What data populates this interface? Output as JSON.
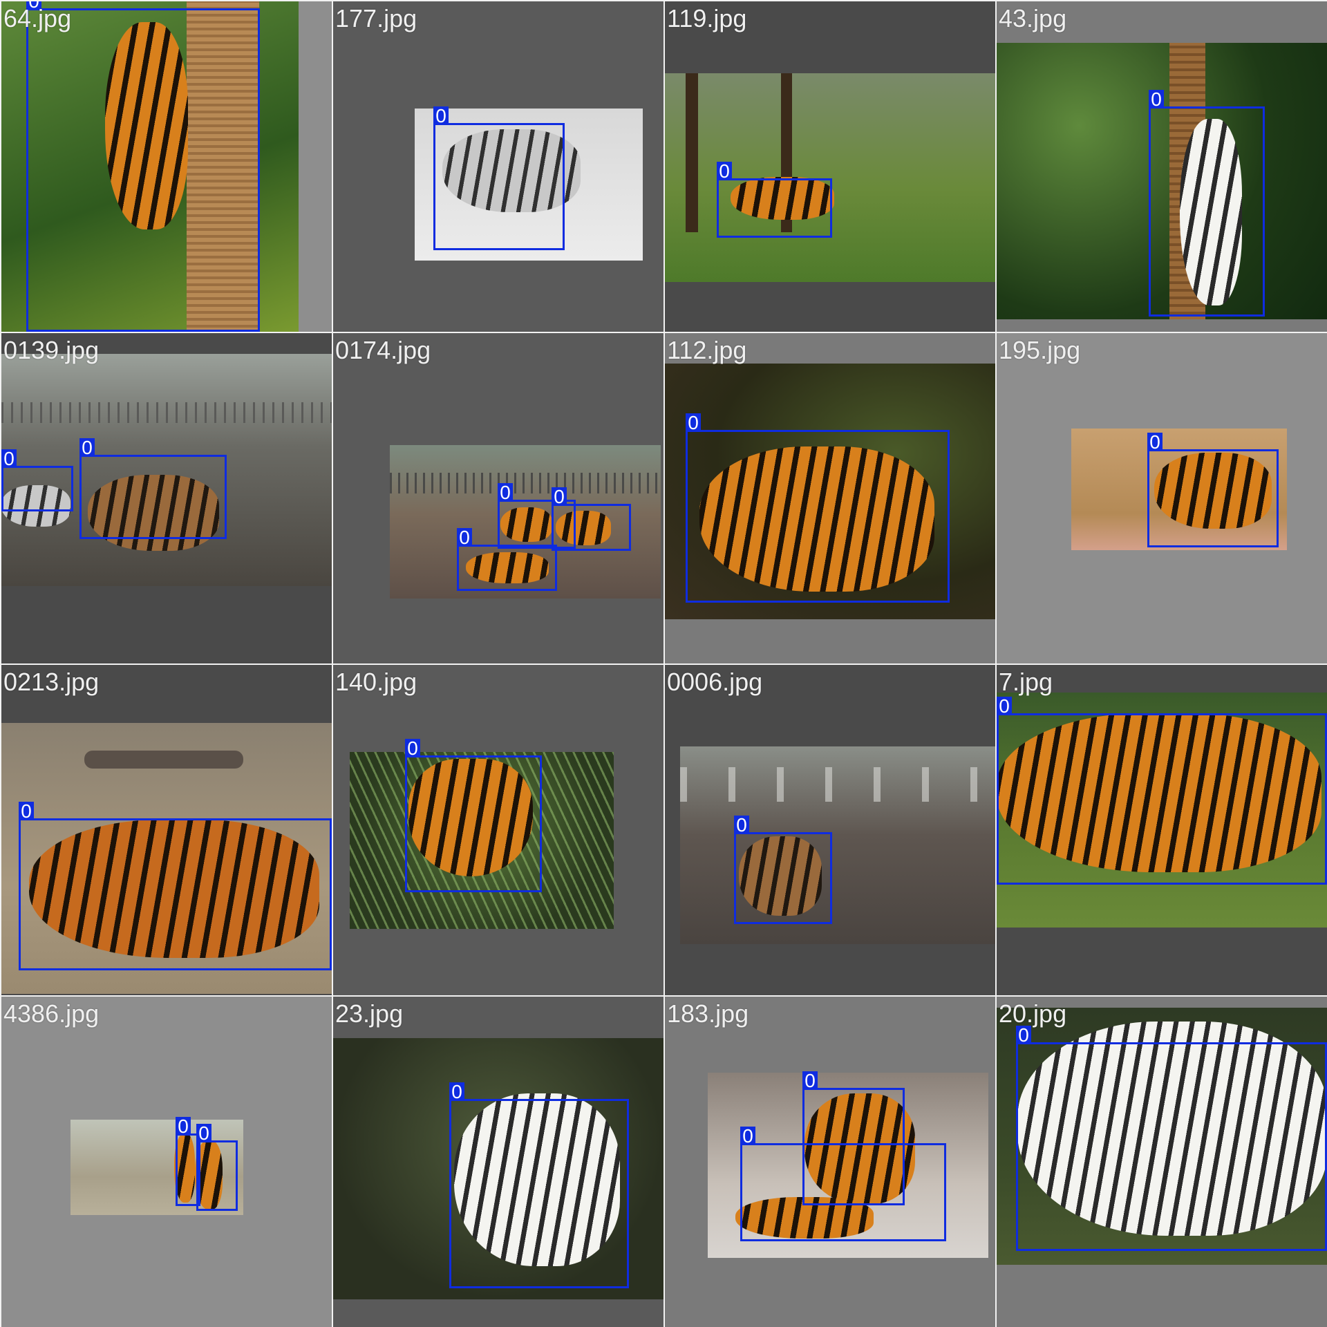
{
  "grid": {
    "box_color": "#0f2ce0",
    "cells": [
      {
        "filename": "64.jpg",
        "bg": "#8e8e8e",
        "label": "0"
      },
      {
        "filename": "177.jpg",
        "bg": "#5a5a5a",
        "label": "0"
      },
      {
        "filename": "119.jpg",
        "bg": "#4a4a4a",
        "label": "0"
      },
      {
        "filename": "43.jpg",
        "bg": "#7a7a7a",
        "label": "0"
      },
      {
        "filename": "0139.jpg",
        "bg": "#4a4a4a",
        "label": "0"
      },
      {
        "filename": "0174.jpg",
        "bg": "#5a5a5a",
        "label": "0"
      },
      {
        "filename": "112.jpg",
        "bg": "#7a7a7a",
        "label": "0"
      },
      {
        "filename": "195.jpg",
        "bg": "#8e8e8e",
        "label": "0"
      },
      {
        "filename": "0213.jpg",
        "bg": "#4a4a4a",
        "label": "0"
      },
      {
        "filename": "140.jpg",
        "bg": "#5a5a5a",
        "label": "0"
      },
      {
        "filename": "0006.jpg",
        "bg": "#4a4a4a",
        "label": "0"
      },
      {
        "filename": "7.jpg",
        "bg": "#4a4a4a",
        "label": "0"
      },
      {
        "filename": "4386.jpg",
        "bg": "#8e8e8e",
        "label": "0"
      },
      {
        "filename": "23.jpg",
        "bg": "#5a5a5a",
        "label": "0"
      },
      {
        "filename": "183.jpg",
        "bg": "#7a7a7a",
        "label": "0"
      },
      {
        "filename": "20.jpg",
        "bg": "#7a7a7a",
        "label": "0"
      }
    ]
  }
}
